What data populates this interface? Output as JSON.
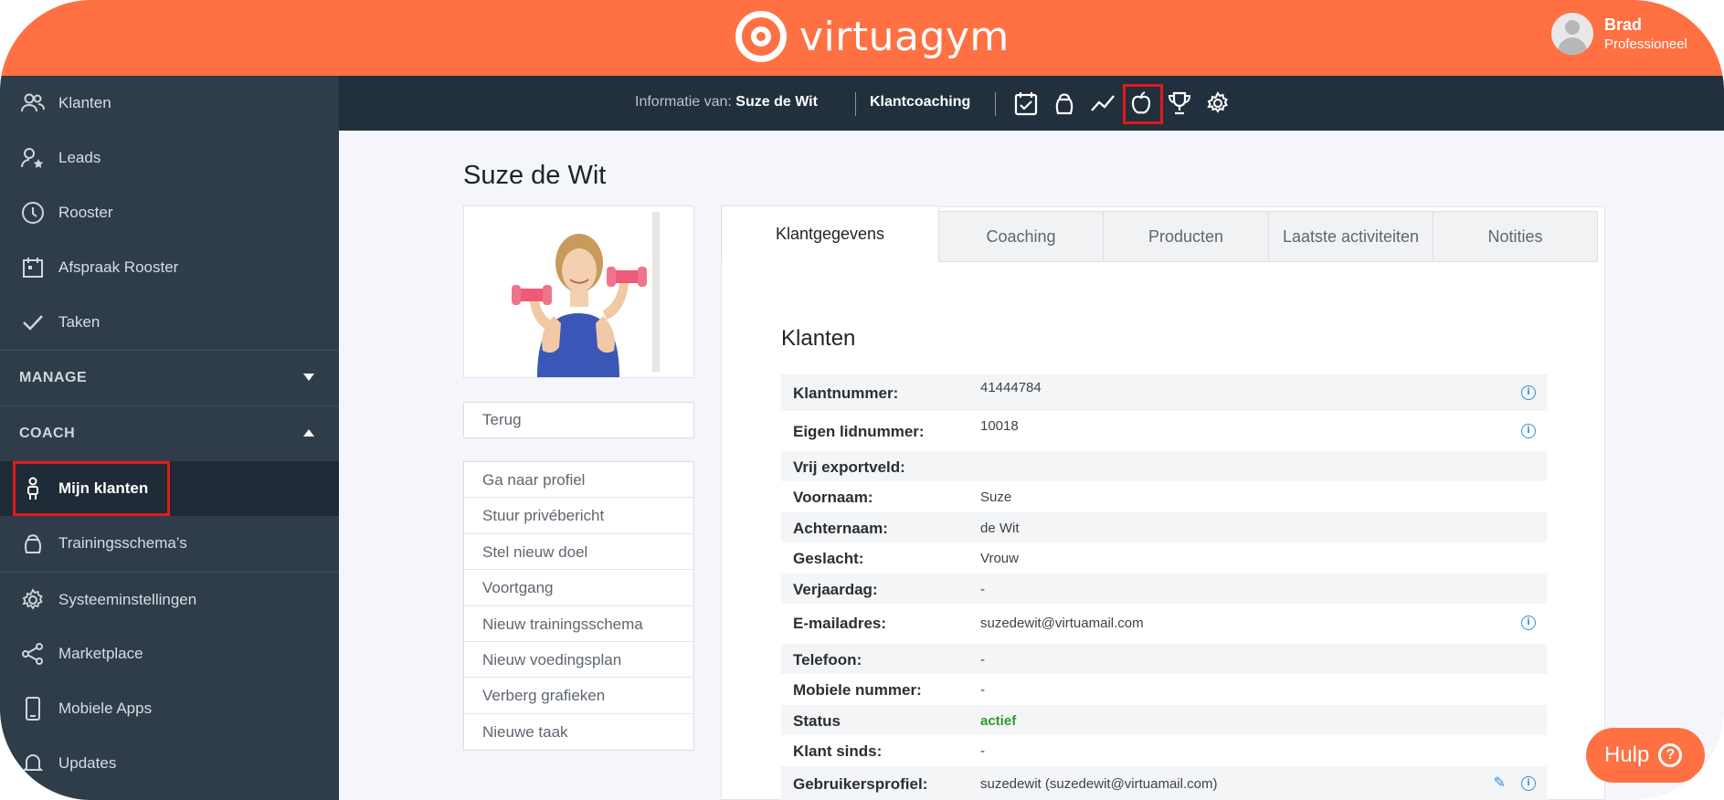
{
  "header": {
    "brand": "virtuagym",
    "user_name": "Brad",
    "user_role": "Professioneel"
  },
  "sidebar": {
    "items": [
      {
        "label": "Klanten",
        "icon": "users-icon"
      },
      {
        "label": "Leads",
        "icon": "user-star-icon"
      },
      {
        "label": "Rooster",
        "icon": "clock-icon"
      },
      {
        "label": "Afspraak Rooster",
        "icon": "calendar-icon"
      },
      {
        "label": "Taken",
        "icon": "check-icon"
      }
    ],
    "manage_label": "MANAGE",
    "coach_label": "COACH",
    "coach_items": [
      {
        "label": "Mijn klanten",
        "icon": "person-icon"
      },
      {
        "label": "Trainingsschema’s",
        "icon": "kettlebell-icon"
      }
    ],
    "bottom_items": [
      {
        "label": "Systeeminstellingen",
        "icon": "gear-icon"
      },
      {
        "label": "Marketplace",
        "icon": "share-icon"
      },
      {
        "label": "Mobiele Apps",
        "icon": "phone-icon"
      },
      {
        "label": "Updates",
        "icon": "bell-icon"
      }
    ]
  },
  "subbar": {
    "info_prefix": "Informatie van:",
    "client_name": "Suze de Wit",
    "coaching": "Klantcoaching",
    "icons": [
      "calendar-check-icon",
      "kettlebell-icon",
      "trend-line-icon",
      "apple-icon",
      "trophy-icon",
      "gear-icon"
    ]
  },
  "client": {
    "title": "Suze de Wit",
    "back_label": "Terug",
    "actions": [
      "Ga naar profiel",
      "Stuur privébericht",
      "Stel nieuw doel",
      "Voortgang",
      "Nieuw trainingsschema",
      "Nieuw voedingsplan",
      "Verberg grafieken",
      "Nieuwe taak"
    ]
  },
  "tabs": [
    "Klantgegevens",
    "Coaching",
    "Producten",
    "Laatste activiteiten",
    "Notities"
  ],
  "details": {
    "section_title": "Klanten",
    "fields": [
      {
        "label": "Klantnummer:",
        "value": "41444784"
      },
      {
        "label": "Eigen lidnummer:",
        "value": "10018"
      },
      {
        "label": "Vrij exportveld:",
        "value": ""
      },
      {
        "label": "Voornaam:",
        "value": "Suze"
      },
      {
        "label": "Achternaam:",
        "value": "de Wit"
      },
      {
        "label": "Geslacht:",
        "value": "Vrouw"
      },
      {
        "label": "Verjaardag:",
        "value": "-"
      },
      {
        "label": "E-mailadres:",
        "value": "suzedewit@virtuamail.com"
      },
      {
        "label": "Telefoon:",
        "value": "-"
      },
      {
        "label": "Mobiele nummer:",
        "value": "-"
      },
      {
        "label": "Status",
        "value": "actief"
      },
      {
        "label": "Klant sinds:",
        "value": "-"
      },
      {
        "label": "Gebruikersprofiel:",
        "value": "suzedewit (suzedewit@virtuamail.com)"
      }
    ]
  },
  "help_label": "Hulp",
  "colors": {
    "brand": "#ff7043",
    "sidebar": "#2f3d4a",
    "subbar": "#222f3c",
    "highlight": "#e01b1b",
    "link": "#2d8ee0",
    "status_active": "#2e9a2e"
  }
}
